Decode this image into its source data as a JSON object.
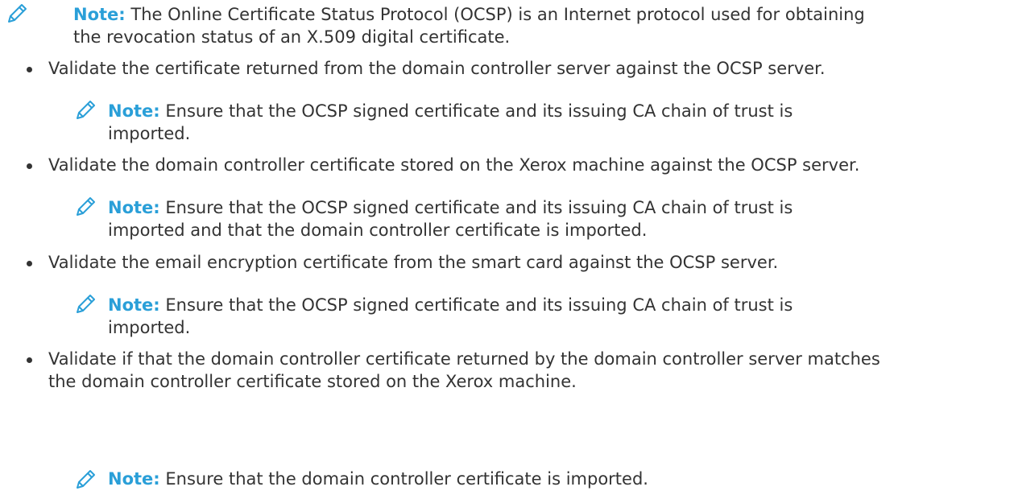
{
  "note_label": "Note:",
  "top_note": {
    "line1": "The Online Certificate Status Protocol (OCSP) is an Internet protocol used for obtaining",
    "line2": "the revocation status of an X.509 digital certificate."
  },
  "items": [
    {
      "bullet": "Validate the certificate returned from the domain controller server against the OCSP server.",
      "note_line1": "Ensure that the OCSP signed certificate and its issuing CA chain of trust is",
      "note_line2": "imported."
    },
    {
      "bullet": "Validate the domain controller certificate stored on the Xerox machine against the OCSP server.",
      "note_line1": "Ensure that the OCSP signed certificate and its issuing CA chain of trust is",
      "note_line2": "imported and that the domain controller certificate is imported."
    },
    {
      "bullet": "Validate the email encryption certificate from the smart card against the OCSP server.",
      "note_line1": "Ensure that the OCSP signed certificate and its issuing CA chain of trust is",
      "note_line2": "imported."
    },
    {
      "bullet_line1": "Validate if that the domain controller certificate returned by the domain controller server matches",
      "bullet_line2": "the domain controller certificate stored on the Xerox machine.",
      "note_line1": "Ensure that the domain controller certificate is imported."
    }
  ],
  "colors": {
    "accent": "#2a9fd8",
    "text": "#333333"
  }
}
